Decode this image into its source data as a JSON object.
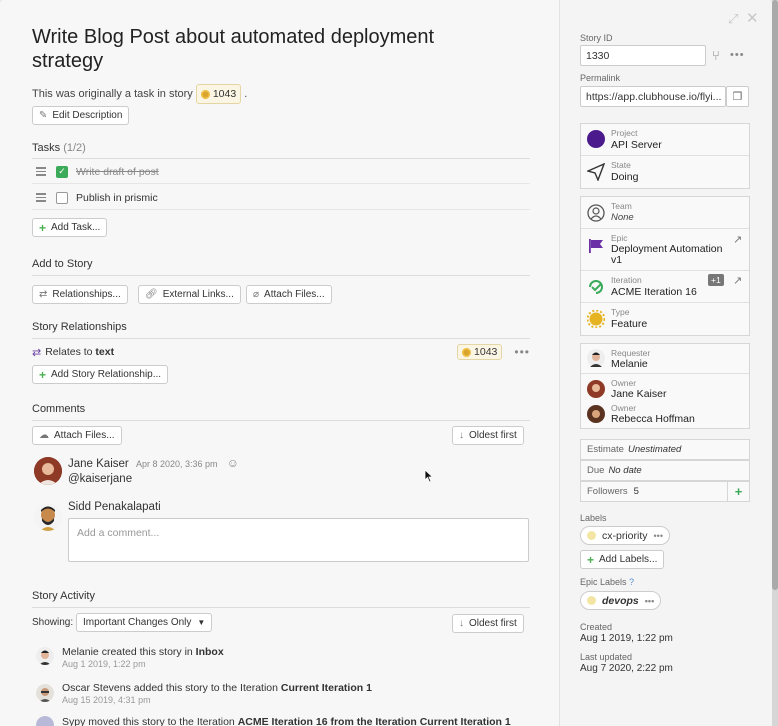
{
  "window": {
    "expand_icon": "expand-icon",
    "close_icon": "close-icon"
  },
  "story": {
    "title": "Write Blog Post about automated deployment strategy",
    "origin_prefix": "This was originally a task in story",
    "origin_story_id": "1043",
    "origin_suffix": ".",
    "edit_description_label": "Edit Description"
  },
  "tasks": {
    "heading": "Tasks",
    "count": "(1/2)",
    "items": [
      {
        "label": "Write draft of post",
        "done": true
      },
      {
        "label": "Publish in prismic",
        "done": false
      }
    ],
    "add_label": "Add Task..."
  },
  "add_to_story": {
    "heading": "Add to Story",
    "relationships_label": "Relationships...",
    "external_links_label": "External Links...",
    "attach_files_label": "Attach Files..."
  },
  "relationships": {
    "heading": "Story Relationships",
    "relates_prefix": "Relates to",
    "relates_target": "text",
    "story_id": "1043",
    "add_label": "Add Story Relationship..."
  },
  "comments": {
    "heading": "Comments",
    "attach_label": "Attach Files...",
    "sort_label": "Oldest first",
    "items": [
      {
        "author": "Jane Kaiser",
        "meta": "Apr 8 2020, 3:36 pm",
        "body": "@kaiserjane"
      }
    ],
    "current_user": "Sidd Penakalapati",
    "input_placeholder": "Add a comment..."
  },
  "activity": {
    "heading": "Story Activity",
    "showing_label": "Showing:",
    "filter_value": "Important Changes Only",
    "sort_label": "Oldest first",
    "items": [
      {
        "actor": "Melanie",
        "action": "created this story in",
        "target": "Inbox",
        "when": "Aug 1 2019, 1:22 pm"
      },
      {
        "actor": "Oscar Stevens",
        "action": "added this story to the Iteration",
        "target": "Current Iteration 1",
        "when": "Aug 15 2019, 4:31 pm"
      },
      {
        "actor": "Sypy",
        "action": "moved this story to the Iteration",
        "target": "ACME Iteration 16 from the Iteration Current Iteration 1",
        "when": ""
      }
    ]
  },
  "sidebar": {
    "story_id_label": "Story ID",
    "story_id": "1330",
    "permalink_label": "Permalink",
    "permalink": "https://app.clubhouse.io/flyi...",
    "project": {
      "sub": "Project",
      "value": "API Server",
      "color": "#4b1a8c"
    },
    "state": {
      "sub": "State",
      "value": "Doing"
    },
    "team": {
      "sub": "Team",
      "value": "None"
    },
    "epic": {
      "sub": "Epic",
      "value": "Deployment Automation v1",
      "color": "#6b2fa6"
    },
    "iteration": {
      "sub": "Iteration",
      "value": "ACME Iteration 16",
      "badge": "+1",
      "color": "#3bab5a"
    },
    "type": {
      "sub": "Type",
      "value": "Feature",
      "color": "#e6b422"
    },
    "requester": {
      "sub": "Requester",
      "value": "Melanie"
    },
    "owners": [
      {
        "sub": "Owner",
        "value": "Jane Kaiser"
      },
      {
        "sub": "Owner",
        "value": "Rebecca Hoffman"
      }
    ],
    "estimate_label": "Estimate",
    "estimate_value": "Unestimated",
    "due_label": "Due",
    "due_value": "No date",
    "followers_label": "Followers",
    "followers_count": "5",
    "labels_heading": "Labels",
    "labels": [
      "cx-priority"
    ],
    "add_labels_label": "Add Labels...",
    "epic_labels_heading": "Epic Labels",
    "epic_labels": [
      "devops"
    ],
    "created_label": "Created",
    "created_value": "Aug 1 2019, 1:22 pm",
    "updated_label": "Last updated",
    "updated_value": "Aug 7 2020, 2:22 pm"
  }
}
